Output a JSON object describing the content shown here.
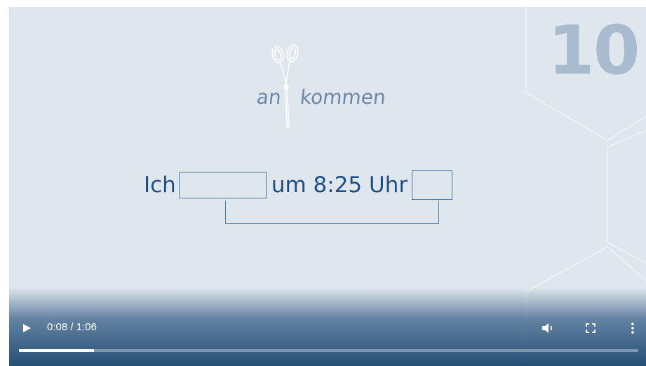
{
  "slide": {
    "chapter_number": "10",
    "logo": {
      "word_left": "an",
      "word_right": "kommen",
      "icon": "scissors-icon"
    },
    "sentence": {
      "word_start": "Ich",
      "middle": "um 8:25 Uhr"
    }
  },
  "player": {
    "current_time": "0:08",
    "separator": " / ",
    "duration": "1:06",
    "progress_fraction": 0.1212,
    "icons": [
      "play-icon",
      "volume-icon",
      "fullscreen-icon",
      "more-options-icon"
    ]
  }
}
